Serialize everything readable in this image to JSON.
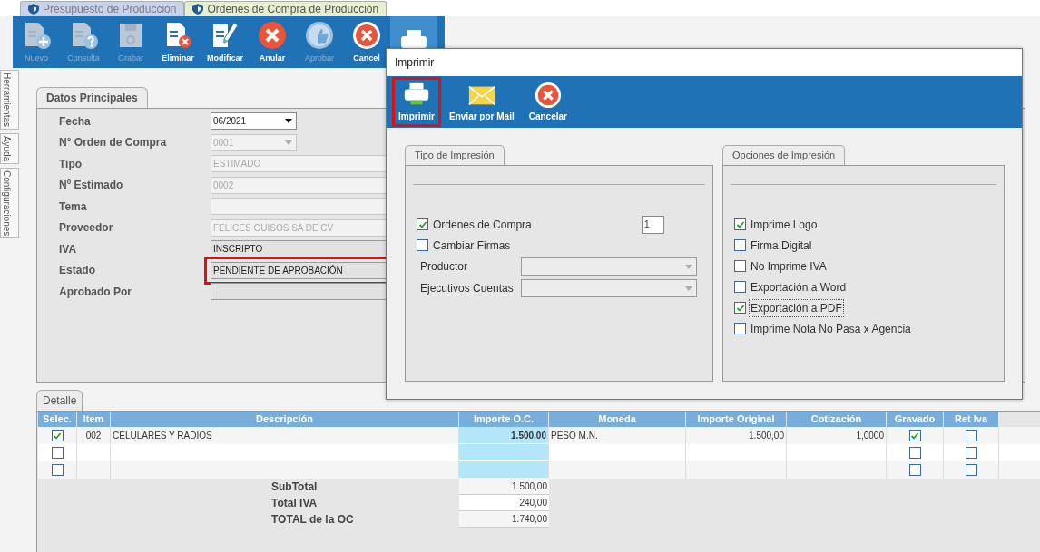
{
  "tabs": [
    {
      "label": "Presupuesto de Producción",
      "selected": false
    },
    {
      "label": "Ordenes de Compra de Producción",
      "selected": true
    }
  ],
  "toolbar": [
    {
      "label": "Nuevo",
      "disabled": true,
      "selected": false
    },
    {
      "label": "Consulta",
      "disabled": true,
      "selected": false
    },
    {
      "label": "Grabar",
      "disabled": true,
      "selected": false
    },
    {
      "label": "Eliminar",
      "disabled": false,
      "selected": false
    },
    {
      "label": "Modificar",
      "disabled": false,
      "selected": false
    },
    {
      "label": "Anular",
      "disabled": false,
      "selected": false
    },
    {
      "label": "Aprobar",
      "disabled": true,
      "selected": false
    },
    {
      "label": "Cancel",
      "disabled": false,
      "selected": false
    },
    {
      "disabled": false,
      "selected": true
    }
  ],
  "side_tabs": [
    "Herramientas",
    "Ayuda",
    "Configuraciones"
  ],
  "main": {
    "tab": "Datos Principales",
    "fields": [
      {
        "label": "Fecha",
        "kind": "dropdown-short",
        "value": "06/2021",
        "disabled": false
      },
      {
        "label": "N° Orden de Compra",
        "kind": "dropdown-short",
        "value": "0001",
        "disabled": true
      },
      {
        "label": "Tipo",
        "kind": "dropdown",
        "value": "ESTIMADO",
        "disabled": true
      },
      {
        "label": "Nº Estimado",
        "kind": "dropdown",
        "value": "0002",
        "disabled": true
      },
      {
        "label": "Tema",
        "kind": "text",
        "disabled": true
      },
      {
        "label": "Proveedor",
        "kind": "dropdown",
        "value": "FELICES GUISOS  SA DE CV",
        "disabled": true
      },
      {
        "label": "IVA",
        "kind": "text",
        "value": "INSCRIPTO",
        "disabled": false
      },
      {
        "label": "Estado",
        "kind": "text",
        "value": "PENDIENTE DE APROBACIÓN",
        "disabled": false,
        "highlighted": true
      },
      {
        "label": "Aprobado Por",
        "kind": "text",
        "disabled": false
      }
    ]
  },
  "detail": {
    "tab": "Detalle",
    "columns": [
      "Selec.",
      "Item",
      "Descripción",
      "Importe O.C.",
      "Moneda",
      "Importe Original",
      "Cotización",
      "Gravado",
      "Ret Iva"
    ],
    "rows": [
      {
        "checked": true,
        "item": "002",
        "description": "CELULARES Y RADIOS",
        "importe_oc": "1.500,00",
        "moneda": "PESO M.N.",
        "importe_original": "1.500,00",
        "cotizacion": "1,0000",
        "gravado": true,
        "ret_iva": false
      },
      {
        "checked": false,
        "gravado": false,
        "ret_iva": false
      },
      {
        "checked": false,
        "gravado": false,
        "ret_iva": false
      }
    ],
    "totals": [
      {
        "label": "SubTotal",
        "value": "1.500,00"
      },
      {
        "label": "Total IVA",
        "value": "240,00"
      },
      {
        "label": "TOTAL de la OC",
        "value": "1.740,00"
      }
    ]
  },
  "dialog": {
    "title": "Imprimir",
    "toolbar": [
      {
        "label": "Imprimir",
        "highlighted": true
      },
      {
        "label": "Enviar por Mail",
        "highlighted": false
      },
      {
        "label": "Cancelar",
        "highlighted": false
      }
    ],
    "tipo": {
      "title": "Tipo de Impresión",
      "options": [
        {
          "label": "Ordenes de Compra",
          "checked": true,
          "copies": "1"
        },
        {
          "label": "Cambiar Firmas",
          "checked": false
        }
      ],
      "fields": [
        {
          "label": "Productor"
        },
        {
          "label": "Ejecutivos Cuentas"
        }
      ]
    },
    "opciones": {
      "title": "Opciones de Impresión",
      "options": [
        {
          "label": "Imprime Logo",
          "checked": true,
          "focused": false
        },
        {
          "label": "Firma Digital",
          "checked": false,
          "focused": false
        },
        {
          "label": "No Imprime IVA",
          "checked": false,
          "focused": false
        },
        {
          "label": "Exportación a Word",
          "checked": false,
          "focused": false
        },
        {
          "label": "Exportación a PDF",
          "checked": true,
          "focused": true
        },
        {
          "label": "Imprime Nota No Pasa x Agencia",
          "checked": false,
          "focused": false
        }
      ]
    }
  }
}
